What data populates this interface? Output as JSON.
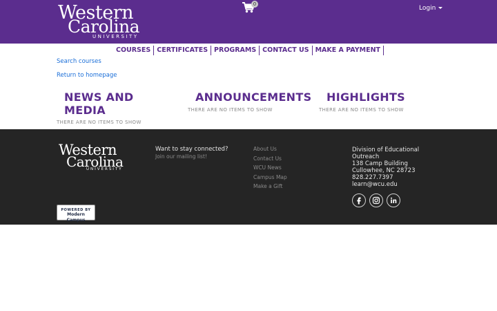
{
  "header": {
    "logo": {
      "line1": "Western",
      "line2": "Carolina",
      "line3": "UNIVERSITY"
    },
    "cart": {
      "icon": "cart-icon",
      "count": "0"
    },
    "login_label": "Login"
  },
  "nav": {
    "items": [
      "COURSES",
      "CERTIFICATES",
      "PROGRAMS",
      "CONTACT US",
      "MAKE A PAYMENT"
    ]
  },
  "links": {
    "search_courses": "Search courses",
    "return_home": "Return to homepage"
  },
  "sections": {
    "news": {
      "title_line1": "NEWS AND",
      "title_line2": "MEDIA",
      "empty": "THERE ARE NO ITEMS TO SHOW"
    },
    "announcements": {
      "title": "ANNOUNCEMENTS",
      "empty": "THERE ARE NO ITEMS TO SHOW"
    },
    "highlights": {
      "title": "HIGHLIGHTS",
      "empty": "THERE ARE NO ITEMS TO SHOW"
    }
  },
  "footer": {
    "logo": {
      "line1": "Western",
      "line2": "Carolina",
      "line3": "UNIVERSITY"
    },
    "stay_connected": "Want to stay connected?",
    "mailing_list": "Join our mailing list!",
    "links": [
      "About Us",
      "Contact Us",
      "WCU News",
      "Campus Map",
      "Make a Gift"
    ],
    "contact": {
      "line1": "Division of Educational",
      "line2": "Outreach",
      "line3": "138 Camp Building",
      "line4": "Cullowhee, NC 28723",
      "phone": "828.227.7397",
      "email": "learn@wcu.edu"
    },
    "social": [
      "facebook-icon",
      "instagram-icon",
      "linkedin-icon"
    ],
    "powered": {
      "line1": "POWERED BY",
      "line2": "Modern Campus"
    }
  },
  "colors": {
    "brand_purple": "#5b2d8e",
    "footer_bg": "#252525",
    "link_blue": "#1a6ed8"
  }
}
